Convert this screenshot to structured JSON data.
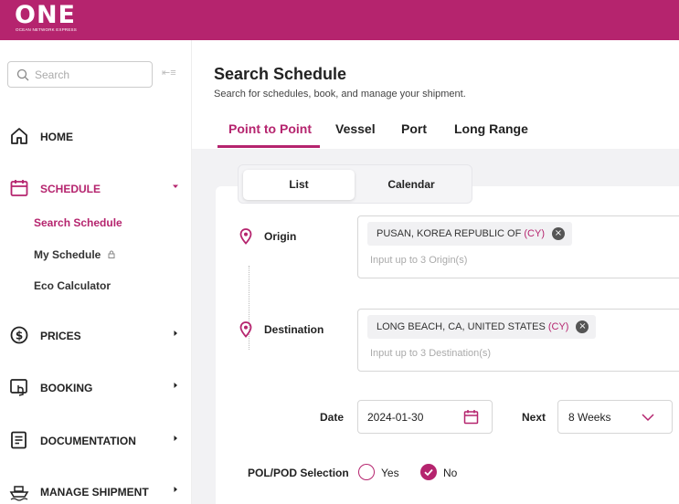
{
  "brand": {
    "logo_text": "ONE",
    "logo_sub": "OCEAN NETWORK EXPRESS",
    "accent": "#b5246e"
  },
  "sidebar": {
    "search_placeholder": "Search",
    "items": [
      {
        "label": "HOME",
        "icon": "home-icon"
      },
      {
        "label": "SCHEDULE",
        "icon": "calendar-icon"
      },
      {
        "label": "PRICES",
        "icon": "dollar-icon"
      },
      {
        "label": "BOOKING",
        "icon": "booking-icon"
      },
      {
        "label": "DOCUMENTATION",
        "icon": "document-icon"
      },
      {
        "label": "MANAGE SHIPMENT",
        "icon": "ship-icon"
      }
    ],
    "schedule_sub": [
      {
        "label": "Search Schedule"
      },
      {
        "label": "My Schedule"
      },
      {
        "label": "Eco Calculator"
      }
    ]
  },
  "main": {
    "title": "Search Schedule",
    "subtitle": "Search for schedules, book, and manage your shipment.",
    "tabs": [
      {
        "label": "Point to Point"
      },
      {
        "label": "Vessel"
      },
      {
        "label": "Port"
      },
      {
        "label": "Long Range"
      }
    ],
    "view_toggle": [
      {
        "label": "List"
      },
      {
        "label": "Calendar"
      }
    ]
  },
  "form": {
    "origin": {
      "label": "Origin",
      "chip_text": "PUSAN, KOREA REPUBLIC OF",
      "chip_tag": "(CY)",
      "placeholder": "Input up to 3 Origin(s)"
    },
    "destination": {
      "label": "Destination",
      "chip_text": "LONG BEACH, CA, UNITED STATES",
      "chip_tag": "(CY)",
      "placeholder": "Input up to 3 Destination(s)"
    },
    "date": {
      "label": "Date",
      "value": "2024-01-30"
    },
    "next": {
      "label": "Next",
      "value": "8 Weeks"
    },
    "pol_pod": {
      "label": "POL/POD Selection",
      "yes": "Yes",
      "no": "No",
      "selected": "No"
    }
  }
}
